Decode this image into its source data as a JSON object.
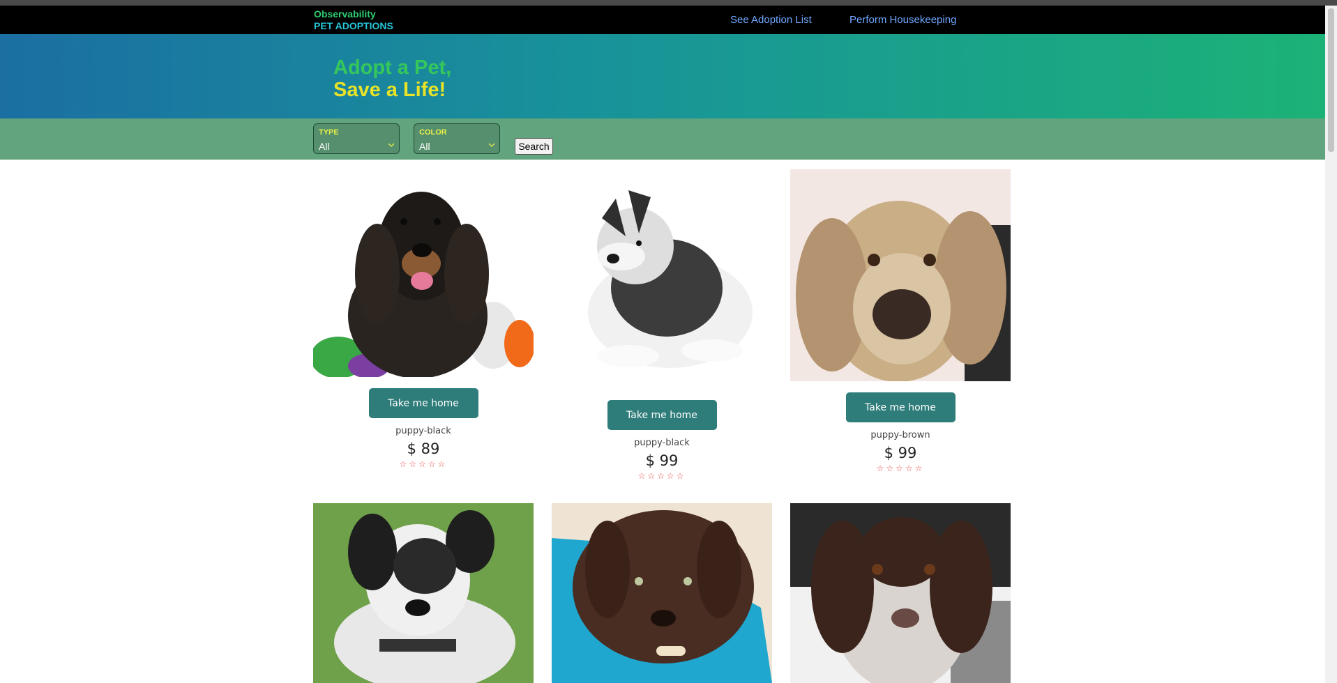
{
  "header": {
    "brand_top": "Observability",
    "brand_bottom": "PET ADOPTIONS",
    "nav": [
      "See Adoption List",
      "Perform Housekeeping"
    ]
  },
  "hero": {
    "line1": "Adopt a Pet,",
    "line2": "Save a Life!"
  },
  "filters": {
    "type_label": "TYPE",
    "type_value": "All",
    "color_label": "COLOR",
    "color_value": "All",
    "search_label": "Search"
  },
  "cards": [
    {
      "button": "Take me home",
      "name": "puppy-black",
      "price": "$ 89",
      "stars": "☆☆☆☆☆"
    },
    {
      "button": "Take me home",
      "name": "puppy-black",
      "price": "$ 99",
      "stars": "☆☆☆☆☆"
    },
    {
      "button": "Take me home",
      "name": "puppy-brown",
      "price": "$ 99",
      "stars": "☆☆☆☆☆"
    }
  ],
  "colors": {
    "topbar": "#000000",
    "hero_start": "#1b6fa2",
    "hero_end": "#1cb277",
    "filter_bar": "#62a47e",
    "button": "#2e7d7a",
    "stars": "#e84040"
  }
}
